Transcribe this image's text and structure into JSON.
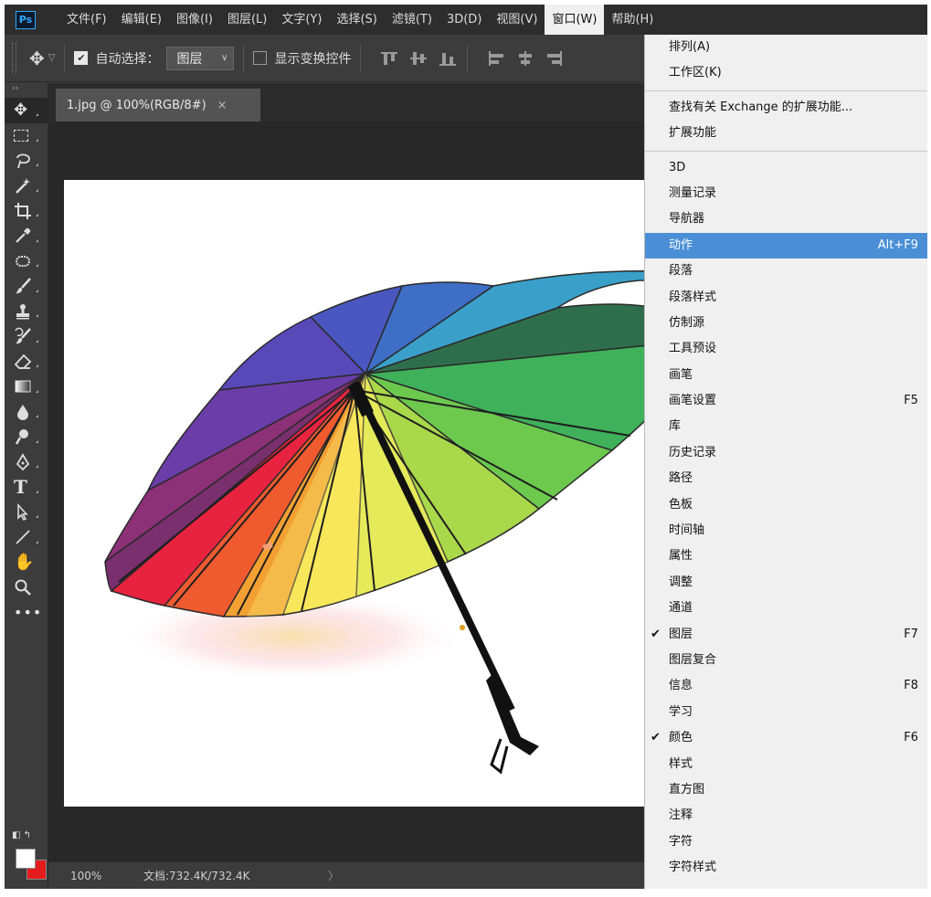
{
  "app": {
    "logo": "Ps"
  },
  "menubar": {
    "items": [
      "文件(F)",
      "编辑(E)",
      "图像(I)",
      "图层(L)",
      "文字(Y)",
      "选择(S)",
      "滤镜(T)",
      "3D(D)",
      "视图(V)",
      "窗口(W)",
      "帮助(H)"
    ],
    "active": "窗口(W)"
  },
  "options": {
    "auto_select_label": "自动选择：",
    "auto_select_checked": true,
    "layer_select_value": "图层",
    "show_transform_label": "显示变换控件",
    "show_transform_checked": false
  },
  "document": {
    "tab_title": "1.jpg @ 100%(RGB/8#)",
    "close_glyph": "×"
  },
  "statusbar": {
    "zoom": "100%",
    "doc_size": "文档:732.4K/732.4K",
    "arrow": "〉"
  },
  "window_menu": {
    "group1": [
      {
        "label": "排列(A)"
      },
      {
        "label": "工作区(K)"
      }
    ],
    "group2": [
      {
        "label": "查找有关 Exchange 的扩展功能..."
      },
      {
        "label": "扩展功能"
      }
    ],
    "group3": [
      {
        "label": "3D"
      },
      {
        "label": "测量记录"
      },
      {
        "label": "导航器"
      },
      {
        "label": "动作",
        "shortcut": "Alt+F9",
        "highlighted": true
      },
      {
        "label": "段落"
      },
      {
        "label": "段落样式"
      },
      {
        "label": "仿制源"
      },
      {
        "label": "工具预设"
      },
      {
        "label": "画笔"
      },
      {
        "label": "画笔设置",
        "shortcut": "F5"
      },
      {
        "label": "库"
      },
      {
        "label": "历史记录"
      },
      {
        "label": "路径"
      },
      {
        "label": "色板"
      },
      {
        "label": "时间轴"
      },
      {
        "label": "属性"
      },
      {
        "label": "调整"
      },
      {
        "label": "通道"
      },
      {
        "label": "图层",
        "shortcut": "F7",
        "checked": true
      },
      {
        "label": "图层复合"
      },
      {
        "label": "信息",
        "shortcut": "F8"
      },
      {
        "label": "学习"
      },
      {
        "label": "颜色",
        "shortcut": "F6",
        "checked": true
      },
      {
        "label": "样式"
      },
      {
        "label": "直方图"
      },
      {
        "label": "注释"
      },
      {
        "label": "字符"
      },
      {
        "label": "字符样式"
      }
    ]
  },
  "colors": {
    "foreground": "#ffffff",
    "background": "#e31b1b",
    "highlight": "#4a8fd6"
  }
}
